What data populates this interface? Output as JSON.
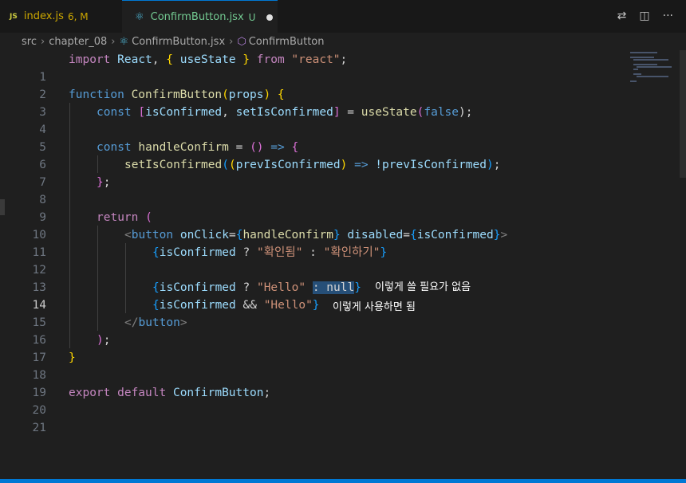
{
  "tabs": [
    {
      "icon_text": "JS",
      "name": "index.js",
      "status": "6, M"
    },
    {
      "name": "ConfirmButton.jsx",
      "status": "U"
    }
  ],
  "toolbar_icons": [
    "compare-changes-icon",
    "split-editor-icon",
    "more-actions-icon"
  ],
  "breadcrumb": {
    "items": [
      "src",
      "chapter_08",
      "ConfirmButton.jsx",
      "ConfirmButton"
    ]
  },
  "active_line": 14,
  "lines": [
    "1",
    "2",
    "3",
    "4",
    "5",
    "6",
    "7",
    "8",
    "9",
    "10",
    "11",
    "12",
    "13",
    "14",
    "15",
    "16",
    "17",
    "18",
    "19",
    "20",
    "21"
  ],
  "code": {
    "l1": {
      "t1": "import",
      "t2": "React",
      "t3": ", ",
      "t4": "{",
      "t5": " useState ",
      "t6": "}",
      "t7": " from ",
      "t8": "\"react\"",
      "t9": ";"
    },
    "l3": {
      "t1": "function",
      "t2": " ConfirmButton",
      "t3": "(",
      "t4": "props",
      "t5": ")",
      "t6": " {"
    },
    "l4": {
      "t1": "const",
      "t2": " [",
      "t3": "isConfirmed",
      "t4": ", ",
      "t5": "setIsConfirmed",
      "t6": "]",
      "t7": " = ",
      "t8": "useState",
      "t9": "(",
      "t10": "false",
      "t11": ");"
    },
    "l6": {
      "t1": "const",
      "t2": " handleConfirm",
      "t3": " = ",
      "t4": "()",
      "t5": " =>",
      "t6": " {"
    },
    "l7": {
      "t1": "setIsConfirmed",
      "t2": "(",
      "t3": "(",
      "t4": "prevIsConfirmed",
      "t5": ")",
      "t6": " =>",
      "t7": " !prevIsConfirmed",
      "t8": ")",
      "t9": ";"
    },
    "l8": {
      "t1": "}",
      "t2": ";"
    },
    "l10": {
      "t1": "return",
      "t2": " ("
    },
    "l11": {
      "t1": "<",
      "t2": "button",
      "t3": " onClick",
      "t4": "=",
      "t5": "{",
      "t6": "handleConfirm",
      "t7": "}",
      "t8": " disabled",
      "t9": "=",
      "t10": "{",
      "t11": "isConfirmed",
      "t12": "}",
      "t13": ">"
    },
    "l12": {
      "t1": "{",
      "t2": "isConfirmed",
      "t3": " ? ",
      "t4": "\"확인됨\"",
      "t5": " : ",
      "t6": "\"확인하기\"",
      "t7": "}"
    },
    "l14": {
      "t1": "{",
      "t2": "isConfirmed",
      "t3": " ? ",
      "t4": "\"Hello\"",
      "t5": " ",
      "t6": ": null",
      "t7": "}"
    },
    "l15": {
      "t1": "{",
      "t2": "isConfirmed",
      "t3": " && ",
      "t4": "\"Hello\"",
      "t5": "}"
    },
    "l16": {
      "t1": "</",
      "t2": "button",
      "t3": ">"
    },
    "l17": {
      "t1": ")",
      "t2": ";"
    },
    "l18": {
      "t1": "}"
    },
    "l20": {
      "t1": "export",
      "t2": " default",
      "t3": " ConfirmButton",
      "t4": ";"
    }
  },
  "annotations": {
    "note1": "이렇게 쓸 필요가 없음",
    "note2": "이렇게 사용하면 됨"
  }
}
